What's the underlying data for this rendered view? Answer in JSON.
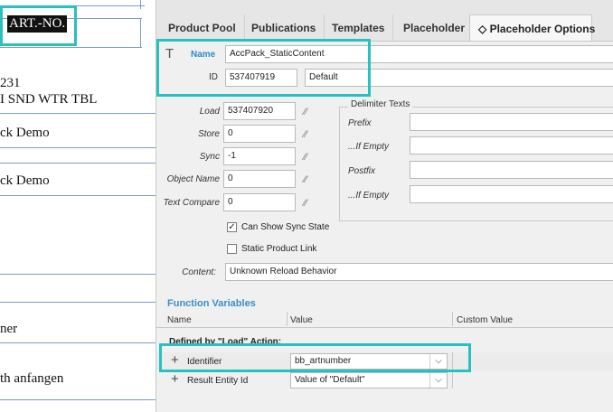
{
  "document": {
    "art_no": "ART.-NO.",
    "lines": [
      "231",
      "I SND WTR TBL",
      "ck Demo",
      "ck Demo",
      "ner",
      "th anfangen"
    ]
  },
  "tabs": [
    {
      "label": "Product Pool"
    },
    {
      "label": "Publications"
    },
    {
      "label": "Templates"
    },
    {
      "label": "Placeholder"
    },
    {
      "label": "Placeholder Options",
      "icon": "◇"
    }
  ],
  "header": {
    "type_icon": "T",
    "name_label": "Name",
    "name_value": "AccPack_StaticContent",
    "id_label": "ID",
    "id_value": "537407919",
    "default_value": "Default"
  },
  "fields": {
    "load_label": "Load",
    "load_value": "537407920",
    "store_label": "Store",
    "store_value": "0",
    "sync_label": "Sync",
    "sync_value": "-1",
    "object_name_label": "Object Name",
    "object_name_value": "0",
    "text_compare_label": "Text Compare",
    "text_compare_value": "0",
    "link_icon": "⁄⁄"
  },
  "delimiter": {
    "title": "Delimiter Texts",
    "prefix_label": "Prefix",
    "if_empty_label": "...If Empty",
    "postfix_label": "Postfix",
    "if_empty2_label": "...If Empty"
  },
  "checkboxes": {
    "sync_state_label": "Can Show Sync State",
    "sync_state_checked": "✓",
    "static_link_label": "Static Product Link"
  },
  "content": {
    "label": "Content:",
    "value": "Unknown Reload Behavior"
  },
  "function_vars": {
    "title": "Function Variables",
    "col_name": "Name",
    "col_value": "Value",
    "col_custom": "Custom Value",
    "group_label": "Defined by \"Load\" Action:",
    "rows": [
      {
        "icon": "+",
        "name": "Identifier",
        "value": "bb_artnumber"
      },
      {
        "icon": "+",
        "name": "Result Entity Id",
        "value": "Value of \"Default\""
      }
    ],
    "chevron": "⌵"
  }
}
